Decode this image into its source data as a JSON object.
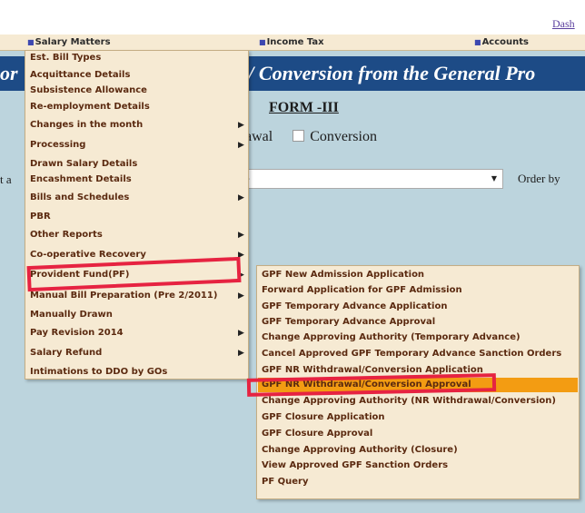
{
  "header": {
    "dash_link": "Dash"
  },
  "menubar": {
    "items": [
      {
        "label": "Salary Matters"
      },
      {
        "label": "Income Tax"
      },
      {
        "label": "Accounts"
      }
    ]
  },
  "banner": {
    "title_left": "or",
    "title": "wal / Conversion from the General Pro"
  },
  "form": {
    "title": "FORM -III",
    "option_withdrawal": "awal",
    "option_conversion": "Conversion",
    "select_label": "t a",
    "select_value": "--",
    "order_by": "Order by"
  },
  "salary_menu": {
    "items": [
      {
        "label": "Est. Bill Types",
        "has_submenu": false
      },
      {
        "label": "Acquittance Details",
        "has_submenu": false
      },
      {
        "label": "Subsistence Allowance",
        "has_submenu": false
      },
      {
        "label": "Re-employment Details",
        "has_submenu": false
      },
      {
        "label": "Changes in the month",
        "has_submenu": true
      },
      {
        "label": "Processing",
        "has_submenu": true
      },
      {
        "label": "Drawn Salary Details",
        "has_submenu": false
      },
      {
        "label": "Encashment Details",
        "has_submenu": false
      },
      {
        "label": "Bills and Schedules",
        "has_submenu": true
      },
      {
        "label": "PBR",
        "has_submenu": false
      },
      {
        "label": "Other Reports",
        "has_submenu": true
      },
      {
        "label": "Co-operative Recovery",
        "has_submenu": true
      },
      {
        "label": "Provident Fund(PF)",
        "has_submenu": true
      },
      {
        "label": "Manual Bill Preparation (Pre 2/2011)",
        "has_submenu": true
      },
      {
        "label": "Manually Drawn",
        "has_submenu": false
      },
      {
        "label": "Pay Revision 2014",
        "has_submenu": true
      },
      {
        "label": "Salary Refund",
        "has_submenu": true
      },
      {
        "label": "Intimations to DDO by GOs",
        "has_submenu": false
      }
    ]
  },
  "pf_menu": {
    "items": [
      {
        "label": "GPF New Admission Application"
      },
      {
        "label": "Forward Application for GPF Admission"
      },
      {
        "label": "GPF Temporary Advance Application"
      },
      {
        "label": "GPF Temporary Advance Approval"
      },
      {
        "label": "Change Approving Authority (Temporary Advance)"
      },
      {
        "label": "Cancel Approved GPF Temporary Advance Sanction Orders"
      },
      {
        "label": "GPF NR Withdrawal/Conversion Application"
      },
      {
        "label": "GPF NR Withdrawal/Conversion Approval"
      },
      {
        "label": "Change Approving Authority (NR Withdrawal/Conversion)"
      },
      {
        "label": "GPF Closure Application"
      },
      {
        "label": "GPF Closure Approval"
      },
      {
        "label": "Change Approving Authority (Closure)"
      },
      {
        "label": "View Approved GPF Sanction Orders"
      },
      {
        "label": "PF Query"
      }
    ],
    "selected_index": 7
  },
  "colors": {
    "page_bg": "#bcd4dd",
    "banner_bg": "#1d4b86",
    "menu_bg": "#f6ead3",
    "menu_text": "#5b2a10",
    "highlight": "#f39c12",
    "annotation": "#e62341"
  }
}
